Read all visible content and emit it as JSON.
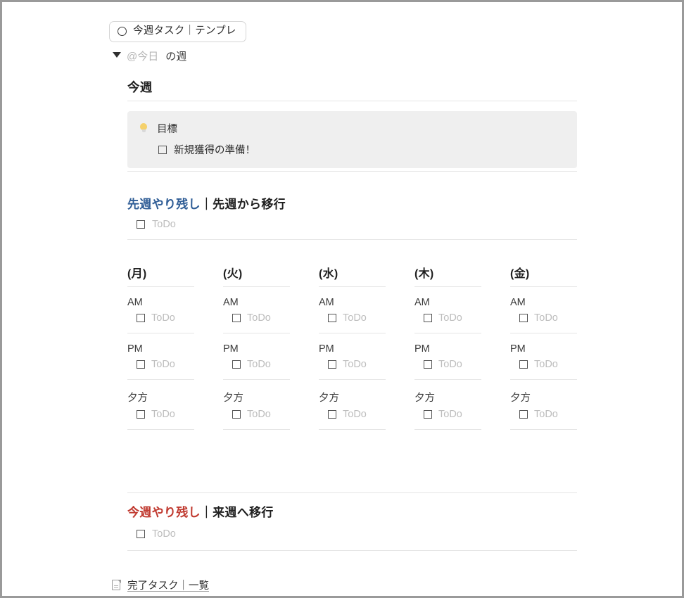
{
  "breadcrumb": {
    "icon": "circle-icon",
    "label": "今週タスク｜テンプレ"
  },
  "toggle": {
    "icon": "triangle-down-icon",
    "mention": "@今日",
    "suffix": "の週"
  },
  "week_heading": "今週",
  "goal": {
    "icon": "lightbulb-icon",
    "title": "目標",
    "task": "新規獲得の準備！"
  },
  "sections": {
    "carryover_prev": {
      "accent_label": "先週やり残し",
      "separator": "｜",
      "rest_label": "先週から移行",
      "accent_color": "#2f5d96",
      "todo_placeholder": "ToDo"
    },
    "carryover_next": {
      "accent_label": "今週やり残し",
      "separator": "｜",
      "rest_label": "来週へ移行",
      "accent_color": "#c0392f",
      "todo_placeholder": "ToDo"
    }
  },
  "week_grid": {
    "slot_labels": [
      "AM",
      "PM",
      "夕方"
    ],
    "todo_placeholder": "ToDo",
    "days": [
      {
        "name": "(月)"
      },
      {
        "name": "(火)"
      },
      {
        "name": "(水)"
      },
      {
        "name": "(木)"
      },
      {
        "name": "(金)"
      }
    ]
  },
  "footer": {
    "icon": "document-icon",
    "label": "完了タスク｜一覧"
  }
}
